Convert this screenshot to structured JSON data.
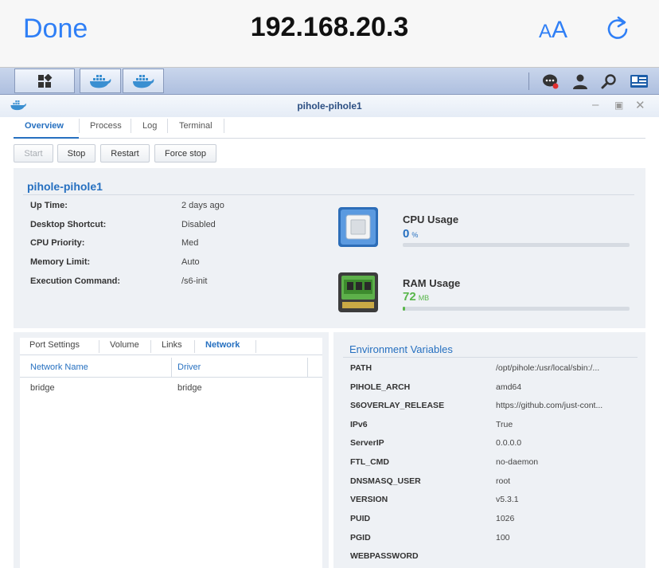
{
  "safari": {
    "done_label": "Done",
    "url": "192.168.20.3",
    "text_size_small": "A",
    "text_size_large": "A"
  },
  "taskbar": {
    "icons": [
      "main-menu-icon",
      "docker-icon",
      "docker-icon",
      "chat-icon",
      "user-icon",
      "search-icon",
      "widgets-icon"
    ]
  },
  "window": {
    "title": "pihole-pihole1"
  },
  "tabs": [
    "Overview",
    "Process",
    "Log",
    "Terminal"
  ],
  "actions": {
    "start": "Start",
    "stop": "Stop",
    "restart": "Restart",
    "force_stop": "Force stop"
  },
  "summary": {
    "name": "pihole-pihole1",
    "fields": [
      {
        "label": "Up Time:",
        "value": "2 days ago"
      },
      {
        "label": "Desktop Shortcut:",
        "value": "Disabled"
      },
      {
        "label": "CPU Priority:",
        "value": "Med"
      },
      {
        "label": "Memory Limit:",
        "value": "Auto"
      },
      {
        "label": "Execution Command:",
        "value": "/s6-init"
      }
    ],
    "cpu": {
      "title": "CPU Usage",
      "value": "0",
      "unit": "%",
      "percent": 0,
      "color": "#2670c0"
    },
    "ram": {
      "title": "RAM Usage",
      "value": "72",
      "unit": "MB",
      "percent": 1,
      "color": "#58b64a"
    }
  },
  "settings_tabs": [
    "Port Settings",
    "Volume",
    "Links",
    "Network"
  ],
  "network_table": {
    "headers": [
      "Network Name",
      "Driver"
    ],
    "rows": [
      [
        "bridge",
        "bridge"
      ]
    ]
  },
  "env": {
    "title": "Environment Variables",
    "vars": [
      {
        "key": "PATH",
        "value": "/opt/pihole:/usr/local/sbin:/..."
      },
      {
        "key": "PIHOLE_ARCH",
        "value": "amd64"
      },
      {
        "key": "S6OVERLAY_RELEASE",
        "value": "https://github.com/just-cont..."
      },
      {
        "key": "IPv6",
        "value": "True"
      },
      {
        "key": "ServerIP",
        "value": "0.0.0.0"
      },
      {
        "key": "FTL_CMD",
        "value": "no-daemon"
      },
      {
        "key": "DNSMASQ_USER",
        "value": "root"
      },
      {
        "key": "VERSION",
        "value": "v5.3.1"
      },
      {
        "key": "PUID",
        "value": "1026"
      },
      {
        "key": "PGID",
        "value": "100"
      },
      {
        "key": "WEBPASSWORD",
        "value": ""
      }
    ]
  }
}
